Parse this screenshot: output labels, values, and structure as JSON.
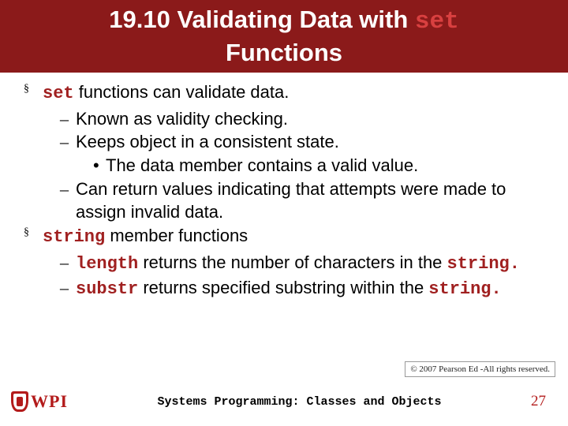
{
  "title": {
    "pre": "19.10 Validating Data with ",
    "kw": "set",
    "post": "Functions"
  },
  "body": {
    "p1": {
      "kw": "set",
      "rest": " functions can validate data."
    },
    "p1a": "Known as validity checking.",
    "p1b": "Keeps object in a consistent state.",
    "p1b1": "The data member contains a valid value.",
    "p1c": "Can return values indicating that attempts were made to assign invalid data.",
    "p2": {
      "kw": "string",
      "rest": " member functions"
    },
    "p2a": {
      "kw": "length",
      "mid": " returns the number of characters in the ",
      "kw2": "string",
      "dot": "."
    },
    "p2b": {
      "kw": "substr",
      "mid": " returns specified substring within the ",
      "kw2": "string",
      "dot": "."
    }
  },
  "copyright": "© 2007 Pearson Ed -All rights reserved.",
  "logo": "WPI",
  "footer_center": "Systems Programming:  Classes and Objects",
  "page": "27"
}
